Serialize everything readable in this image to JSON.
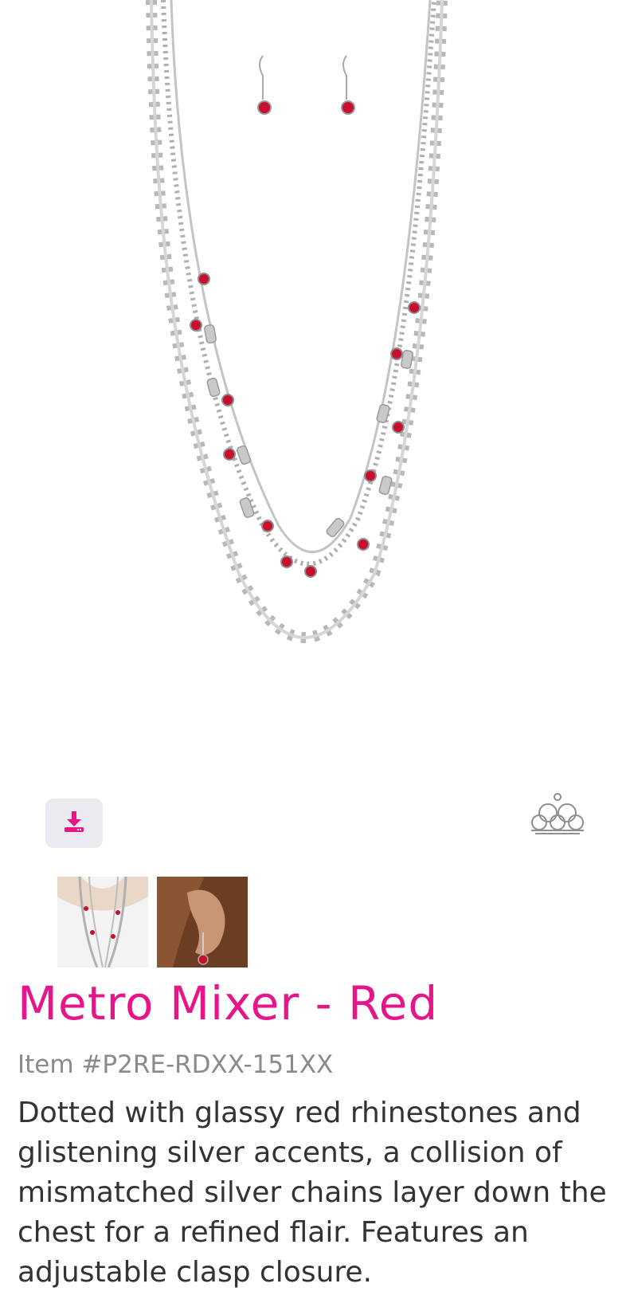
{
  "product": {
    "title": "Metro Mixer - Red",
    "item_number": "Item #P2RE-RDXX-151XX",
    "description": "Dotted with glassy red rhinestones and glistening silver accents, a collision of mismatched silver chains layer down the chest for a refined flair. Features an adjustable clasp closure."
  },
  "icons": {
    "download": "download-icon",
    "logo": "crown-logo"
  },
  "colors": {
    "brand_pink": "#e6168a",
    "rhinestone_red": "#c8102e",
    "silver": "#b4b4b4",
    "button_bg": "#ebebef",
    "text_gray": "#8a8a8a",
    "text_dark": "#333333"
  }
}
